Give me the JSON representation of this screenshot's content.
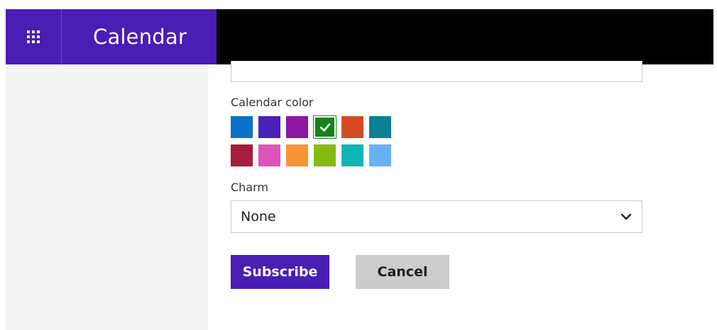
{
  "colors": {
    "header_purple": "#4a1db5",
    "header_black": "#000000",
    "sidebar_bg": "#f3f3f3",
    "subscribe_bg": "#4a1db5",
    "cancel_bg": "#cccccc"
  },
  "header": {
    "app_title": "Calendar",
    "app_launcher_icon": "waffle-grid-icon"
  },
  "form": {
    "calendar_color_label": "Calendar color",
    "swatches": [
      {
        "color": "#0a72c8",
        "selected": false
      },
      {
        "color": "#4b21b8",
        "selected": false
      },
      {
        "color": "#8e16a5",
        "selected": false
      },
      {
        "color": "#17821c",
        "selected": true
      },
      {
        "color": "#d44a22",
        "selected": false
      },
      {
        "color": "#0a8291",
        "selected": false
      },
      {
        "color": "#a71c3c",
        "selected": false
      },
      {
        "color": "#dc54b8",
        "selected": false
      },
      {
        "color": "#f99435",
        "selected": false
      },
      {
        "color": "#85bb11",
        "selected": false
      },
      {
        "color": "#10b6b3",
        "selected": false
      },
      {
        "color": "#66b2fa",
        "selected": false
      }
    ],
    "charm_label": "Charm",
    "charm_value": "None",
    "subscribe_label": "Subscribe",
    "cancel_label": "Cancel"
  }
}
